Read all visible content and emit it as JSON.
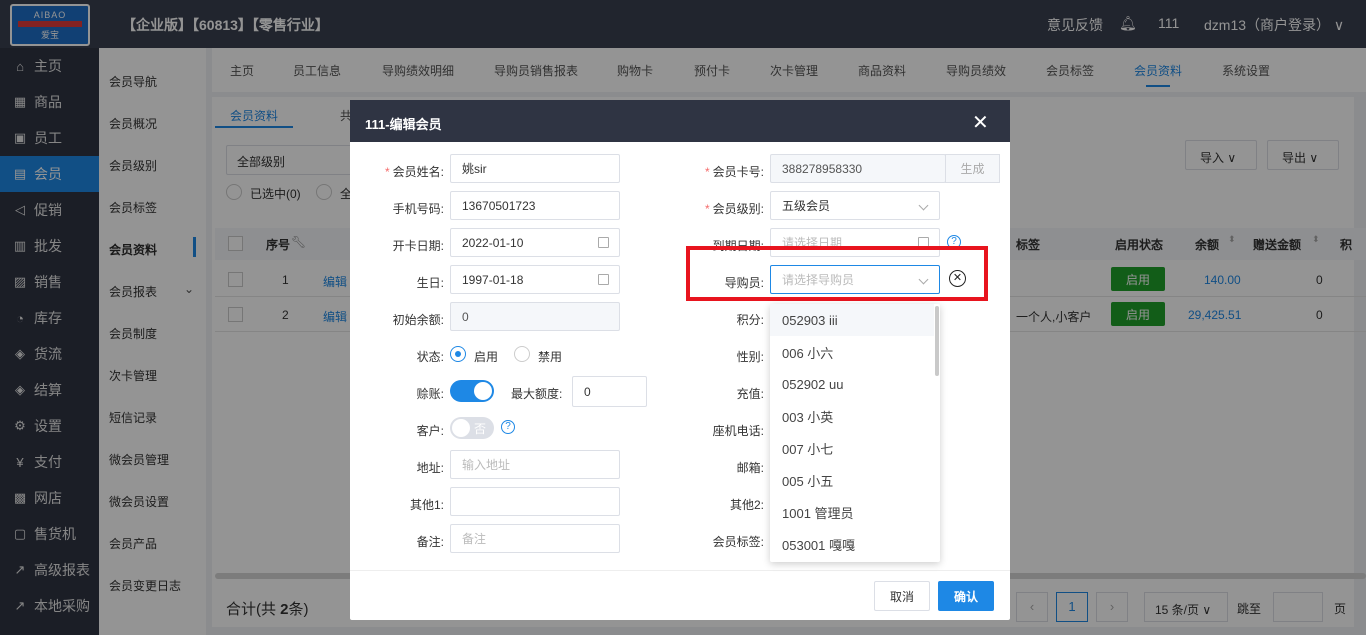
{
  "header": {
    "logo_top": "AIBAO",
    "logo_bottom": "爱宝",
    "title": "【企业版】【60813】【零售行业】",
    "feedback": "意见反馈",
    "count": "111",
    "user": "dzm13（商户登录）"
  },
  "left_menu": [
    {
      "icon": "⌂",
      "label": "主页"
    },
    {
      "icon": "▦",
      "label": "商品"
    },
    {
      "icon": "▣",
      "label": "员工"
    },
    {
      "icon": "▤",
      "label": "会员"
    },
    {
      "icon": "◁",
      "label": "促销"
    },
    {
      "icon": "▥",
      "label": "批发"
    },
    {
      "icon": "▨",
      "label": "销售"
    },
    {
      "icon": "◔",
      "label": "库存"
    },
    {
      "icon": "◈",
      "label": "货流"
    },
    {
      "icon": "◈",
      "label": "结算"
    },
    {
      "icon": "⚙",
      "label": "设置"
    },
    {
      "icon": "¥",
      "label": "支付"
    },
    {
      "icon": "▩",
      "label": "网店"
    },
    {
      "icon": "▢",
      "label": "售货机"
    },
    {
      "icon": "↗",
      "label": "高级报表"
    },
    {
      "icon": "↗",
      "label": "本地采购"
    }
  ],
  "sub_menu": [
    "会员导航",
    "会员概况",
    "会员级别",
    "会员标签",
    "会员资料",
    "会员报表",
    "会员制度",
    "次卡管理",
    "短信记录",
    "微会员管理",
    "微会员设置",
    "会员产品",
    "会员变更日志"
  ],
  "top_tabs": [
    "主页",
    "员工信息",
    "导购绩效明细",
    "导购员销售报表",
    "购物卡",
    "预付卡",
    "次卡管理",
    "商品资料",
    "导购员绩效",
    "会员标签",
    "会员资料",
    "系统设置"
  ],
  "background": {
    "subtab": "会员资料",
    "subtab2": "共",
    "level_select": "全部级别",
    "selected": "已选中(0)",
    "all": "全",
    "import": "导入",
    "export": "导出",
    "col_no": "序号",
    "col_tag": "标签",
    "col_status": "启用状态",
    "col_balance": "余额",
    "col_gift": "赠送金额",
    "col_points": "积",
    "rows": [
      {
        "no": "1",
        "edit": "编辑",
        "tag": "",
        "status": "启用",
        "balance": "140.00",
        "gift": "0"
      },
      {
        "no": "2",
        "edit": "编辑",
        "tag": "一个人,小客户",
        "status": "启用",
        "balance": "29,425.51",
        "gift": "0"
      }
    ],
    "total_prefix": "合计(共 ",
    "total_count": "2",
    "total_suffix": "条)",
    "page": "1",
    "page_size": "15 条/页",
    "goto": "跳至",
    "page_unit": "页"
  },
  "modal": {
    "title": "111-编辑会员",
    "name_label": "会员姓名:",
    "name_value": "姚sir",
    "phone_label": "手机号码:",
    "phone_value": "13670501723",
    "open_date_label": "开卡日期:",
    "open_date_value": "2022-01-10",
    "birthday_label": "生日:",
    "birthday_value": "1997-01-18",
    "init_balance_label": "初始余额:",
    "init_balance_value": "0",
    "status_label": "状态:",
    "status_enabled": "启用",
    "status_disabled": "禁用",
    "credit_label": "赊账:",
    "max_limit_label": "最大额度:",
    "max_limit_value": "0",
    "customer_label": "客户:",
    "customer_toggle": "否",
    "address_label": "地址:",
    "address_placeholder": "输入地址",
    "other1_label": "其他1:",
    "remark_label": "备注:",
    "remark_placeholder": "备注",
    "card_no_label": "会员卡号:",
    "card_no_value": "388278958330",
    "generate": "生成",
    "level_label": "会员级别:",
    "level_value": "五级会员",
    "expire_label": "到期日期:",
    "expire_placeholder": "请选择日期",
    "guide_label": "导购员:",
    "guide_placeholder": "请选择导购员",
    "points_label": "积分:",
    "gender_label": "性别:",
    "recharge_label": "充值:",
    "landline_label": "座机电话:",
    "email_label": "邮箱:",
    "other2_label": "其他2:",
    "tags_label": "会员标签:",
    "cancel": "取消",
    "confirm": "确认"
  },
  "guide_options": [
    "052903 iii",
    "006 小六",
    "052902 uu",
    "003 小英",
    "007 小七",
    "005 小五",
    "1001 管理员",
    "053001 嘎嘎"
  ],
  "colors": {
    "accent": "#1e88e5",
    "highlight": "#e8141e",
    "enabled": "#20a02a",
    "header": "#3a4050"
  }
}
